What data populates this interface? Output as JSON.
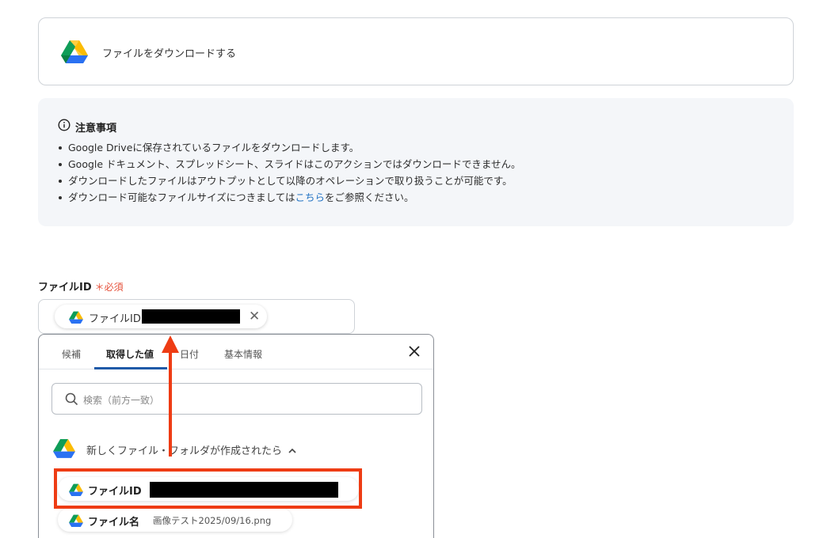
{
  "action": {
    "title": "ファイルをダウンロードする",
    "icon": "google-drive-icon"
  },
  "notice": {
    "title": "注意事項",
    "icon": "info-icon",
    "items": [
      "Google Driveに保存されているファイルをダウンロードします。",
      "Google ドキュメント、スプレッドシート、スライドはこのアクションではダウンロードできません。",
      "ダウンロードしたファイルはアウトプットとして以降のオペレーションで取り扱うことが可能です。"
    ],
    "item4_before": "ダウンロード可能なファイルサイズにつきましては",
    "item4_link": "こちら",
    "item4_after": "をご参照ください。"
  },
  "field": {
    "label": "ファイルID",
    "required_mark": "＊必須",
    "chip_label": "ファイルID",
    "chip_value": "[redacted]",
    "clear_icon": "close-icon"
  },
  "dropdown": {
    "tabs": [
      {
        "label": "候補",
        "active": false
      },
      {
        "label": "取得した値",
        "active": true
      },
      {
        "label": "日付",
        "active": false
      },
      {
        "label": "基本情報",
        "active": false
      }
    ],
    "search_placeholder": "検索（前方一致）",
    "group_label": "新しくファイル・フォルダが作成されたら",
    "items": [
      {
        "label": "ファイルID",
        "value": "[redacted]"
      },
      {
        "label": "ファイル名",
        "value": "画像テスト2025/09/16.png"
      }
    ]
  },
  "colors": {
    "highlight": "#ee3c14",
    "link": "#2474c4",
    "required": "#e5503a",
    "active_tab_underline": "#1f5aa8"
  }
}
